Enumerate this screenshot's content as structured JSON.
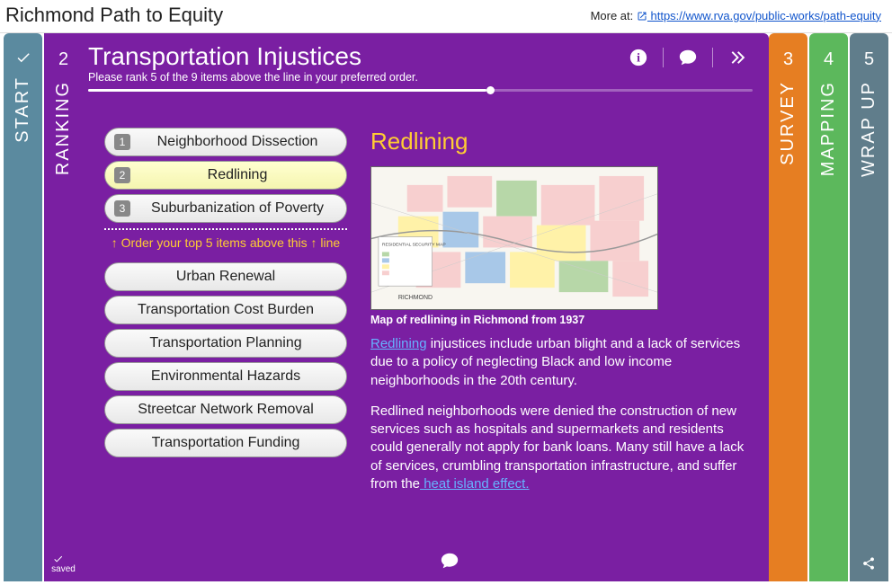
{
  "header": {
    "title": "Richmond Path to Equity",
    "more_at": "More at:",
    "link_text": " https://www.rva.gov/public-works/path-equity"
  },
  "tabs": {
    "start": "START",
    "ranking_num": "2",
    "ranking": "RANKING",
    "survey_num": "3",
    "survey": "SURVEY",
    "mapping_num": "4",
    "mapping": "MAPPING",
    "wrapup_num": "5",
    "wrapup": "WRAP UP",
    "saved": "saved"
  },
  "main": {
    "title": "Transportation Injustices",
    "subtitle": "Please rank 5 of the 9 items above the line in your preferred order."
  },
  "ranked": [
    {
      "num": "1",
      "label": "Neighborhood Dissection"
    },
    {
      "num": "2",
      "label": "Redlining"
    },
    {
      "num": "3",
      "label": "Suburbanization of Poverty"
    }
  ],
  "divider": "↑ Order your top 5 items above this ↑ line",
  "unranked": [
    "Urban Renewal",
    "Transportation Cost Burden",
    "Transportation Planning",
    "Environmental Hazards",
    "Streetcar Network Removal",
    "Transportation Funding"
  ],
  "detail": {
    "title": "Redlining",
    "caption": "Map of redlining in Richmond from 1937",
    "link1": "Redlining",
    "para1_rest": " injustices include urban blight and a lack of services due to a policy of neglecting Black and low income neighborhoods in the 20th century.",
    "para2_start": "Redlined neighborhoods were denied the construction of new services such as hospitals and supermarkets and residents could generally not apply for bank loans. Many still have a lack of services, crumbling transportation infrastructure, and suffer from the",
    "link2": " heat island effect."
  }
}
